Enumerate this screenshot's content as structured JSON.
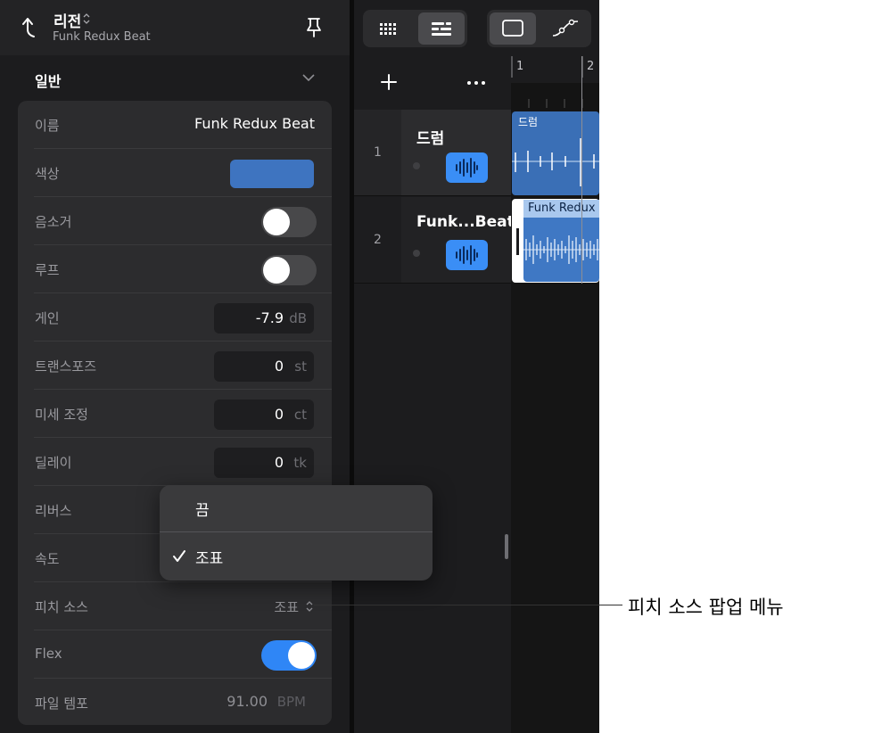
{
  "inspector": {
    "title": "리전",
    "subtitle": "Funk Redux Beat",
    "section": "일반",
    "rows": {
      "name": {
        "label": "이름",
        "value": "Funk Redux Beat"
      },
      "color": {
        "label": "색상",
        "color": "#3e74c0"
      },
      "mute": {
        "label": "음소거",
        "on": false
      },
      "loop": {
        "label": "루프",
        "on": false
      },
      "gain": {
        "label": "게인",
        "value": "-7.9",
        "unit": "dB"
      },
      "transpose": {
        "label": "트랜스포즈",
        "value": "0",
        "unit": "st"
      },
      "fine_tune": {
        "label": "미세 조정",
        "value": "0",
        "unit": "ct"
      },
      "delay": {
        "label": "딜레이",
        "value": "0",
        "unit": "tk"
      },
      "reverse": {
        "label": "리버스"
      },
      "speed": {
        "label": "속도"
      },
      "pitch_source": {
        "label": "피치 소스",
        "value": "조표"
      },
      "flex": {
        "label": "Flex",
        "on": true
      },
      "file_tempo": {
        "label": "파일 템포",
        "value": "91.00",
        "unit": "BPM"
      }
    }
  },
  "popup": {
    "items": [
      {
        "label": "끔",
        "checked": false
      },
      {
        "label": "조표",
        "checked": true
      }
    ]
  },
  "ruler": {
    "bars": [
      "1",
      "2"
    ]
  },
  "tracks": [
    {
      "number": "1",
      "name": "드럼",
      "region": "드럼"
    },
    {
      "number": "2",
      "name": "Funk...Beat",
      "region": "Funk Redux"
    }
  ],
  "callout": "피치 소스 팝업 메뉴",
  "colors": {
    "accent": "#2f86f6",
    "region": "#3a6fb6"
  }
}
